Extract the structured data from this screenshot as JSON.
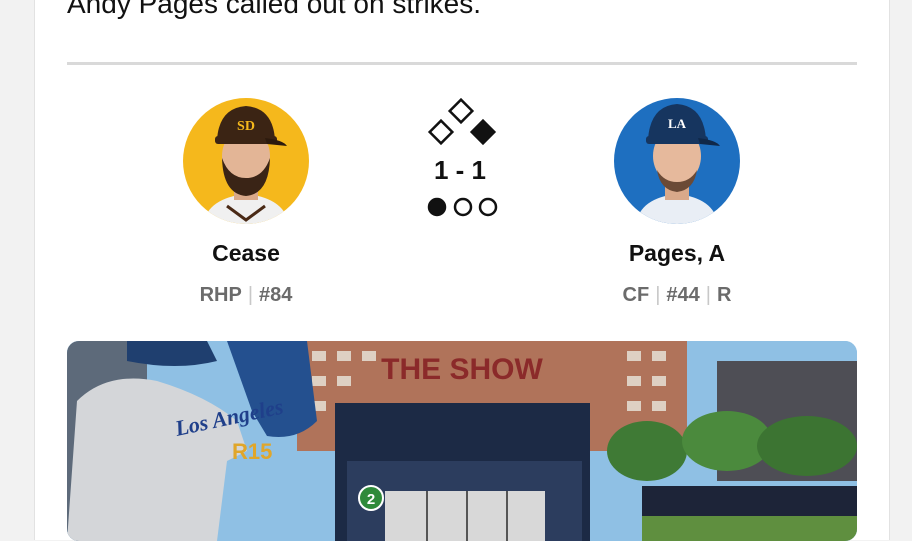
{
  "play": {
    "description": "Andy Pages called out on strikes."
  },
  "pitcher": {
    "name": "Cease",
    "position": "RHP",
    "number": "#84",
    "team_color": "#f5b81c"
  },
  "batter": {
    "name": "Pages, A",
    "position": "CF",
    "number": "#44",
    "bats": "R",
    "team_color": "#1e6fc0"
  },
  "situation": {
    "count": "1 - 1",
    "outs": 1,
    "bases": {
      "first": false,
      "second": false,
      "third": true
    }
  },
  "video": {
    "scoreboard_text": "THE SHOW",
    "pitch_marker": "2"
  }
}
